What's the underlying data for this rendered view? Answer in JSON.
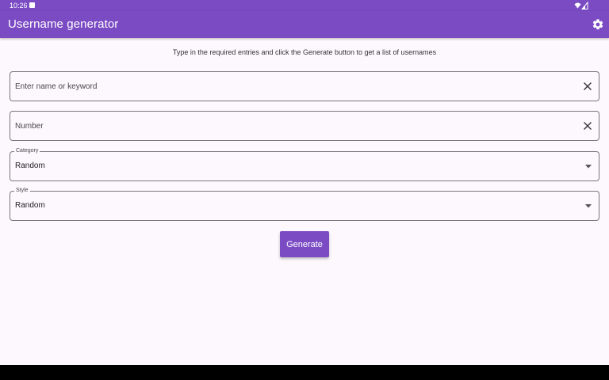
{
  "status_bar": {
    "time": "10:26",
    "notification_icon": "notification-icon",
    "wifi_icon": "wifi-icon",
    "signal_icon": "signal-icon"
  },
  "app_bar": {
    "title": "Username generator",
    "settings_icon": "gear-icon"
  },
  "instructions": "Type in the required entries and click the Generate button to get a list of usernames",
  "fields": {
    "name": {
      "placeholder": "Enter name or keyword",
      "value": "",
      "clear_icon": "close-icon"
    },
    "number": {
      "placeholder": "Number",
      "value": "",
      "clear_icon": "close-icon"
    }
  },
  "selects": {
    "category": {
      "label": "Category",
      "value": "Random",
      "icon": "caret-down-icon"
    },
    "style": {
      "label": "Style",
      "value": "Random",
      "icon": "caret-down-icon"
    }
  },
  "generate_label": "Generate",
  "colors": {
    "primary": "#7b4bc4",
    "background": "#fdf8fd",
    "outline": "#7a7580"
  }
}
